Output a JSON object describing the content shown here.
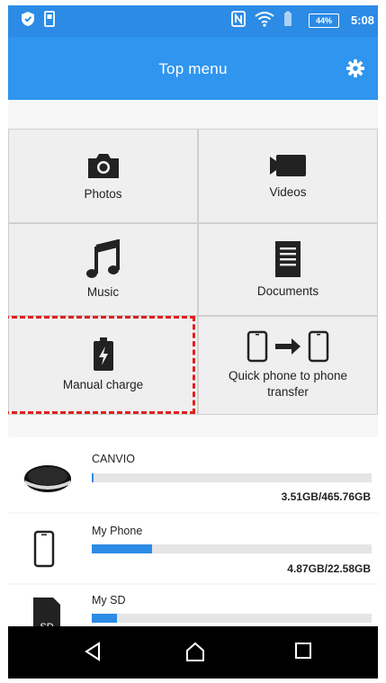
{
  "status_bar": {
    "battery": "44%",
    "time": "5:08",
    "colors": {
      "bar": "#2c8be5"
    }
  },
  "app_bar": {
    "title": "Top menu",
    "settings_icon": "gear-icon",
    "color": "#2f95ef"
  },
  "menu": {
    "tiles": [
      {
        "label": "Photos",
        "icon": "camera-icon"
      },
      {
        "label": "Videos",
        "icon": "video-camera-icon"
      },
      {
        "label": "Music",
        "icon": "music-note-icon"
      },
      {
        "label": "Documents",
        "icon": "document-icon"
      },
      {
        "label": "Manual charge",
        "icon": "battery-charge-icon"
      },
      {
        "label": "Quick phone to phone transfer",
        "icon": "phone-transfer-icon"
      }
    ],
    "highlight_color": "#e0201c"
  },
  "storage": [
    {
      "name": "CANVIO",
      "usage": "3.51GB/465.76GB",
      "fill_fraction": 0.0075,
      "icon": "external-drive-icon"
    },
    {
      "name": "My Phone",
      "usage": "4.87GB/22.58GB",
      "fill_fraction": 0.216,
      "icon": "phone-icon"
    },
    {
      "name": "My SD",
      "usage": "",
      "fill_fraction": 0.09,
      "icon": "sd-card-icon",
      "icon_text": "SD"
    }
  ],
  "nav_bar": {
    "back_icon": "back-icon",
    "home_icon": "home-icon",
    "recents_icon": "recents-icon"
  }
}
